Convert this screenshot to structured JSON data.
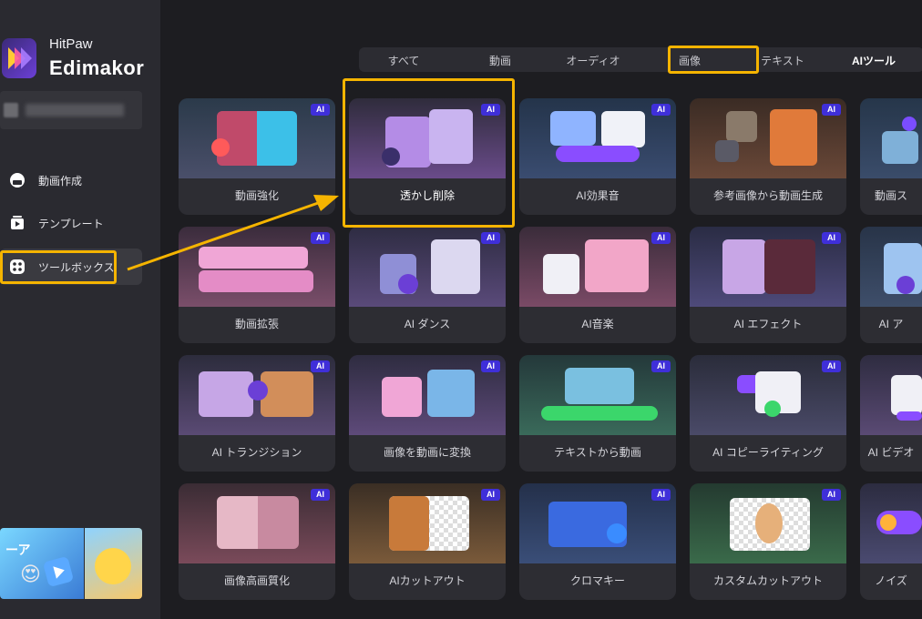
{
  "brand": {
    "small": "HitPaw",
    "large": "Edimakor"
  },
  "nav": [
    {
      "label": "動画作成",
      "icon": "home-icon"
    },
    {
      "label": "テンプレート",
      "icon": "template-icon"
    },
    {
      "label": "ツールボックス",
      "icon": "toolbox-icon",
      "active": true
    }
  ],
  "promo": {
    "text": "ーア",
    "emoji": "😍"
  },
  "tabs": [
    {
      "label": "すべて"
    },
    {
      "label": "動画"
    },
    {
      "label": "オーディオ"
    },
    {
      "label": "画像"
    },
    {
      "label": "テキスト"
    },
    {
      "label": "AIツール",
      "active": true
    }
  ],
  "badge": "AI",
  "cards": [
    {
      "label": "動画強化"
    },
    {
      "label": "透かし削除"
    },
    {
      "label": "AI効果音"
    },
    {
      "label": "参考画像から動画生成"
    },
    {
      "label": "動画ス"
    },
    {
      "label": "動画拡張"
    },
    {
      "label": "AI ダンス"
    },
    {
      "label": "AI音楽"
    },
    {
      "label": "AI エフェクト"
    },
    {
      "label": "AI ア"
    },
    {
      "label": "AI トランジション"
    },
    {
      "label": "画像を動画に変換"
    },
    {
      "label": "テキストから動画"
    },
    {
      "label": "AI コピーライティング"
    },
    {
      "label": "AI ビデオ"
    },
    {
      "label": "画像高画質化"
    },
    {
      "label": "AIカットアウト"
    },
    {
      "label": "クロマキー"
    },
    {
      "label": "カスタムカットアウト"
    },
    {
      "label": "ノイズ"
    }
  ],
  "colors": {
    "highlight": "#f5b400",
    "badge": "#3f2fd9",
    "accent": "#7b4dff"
  }
}
